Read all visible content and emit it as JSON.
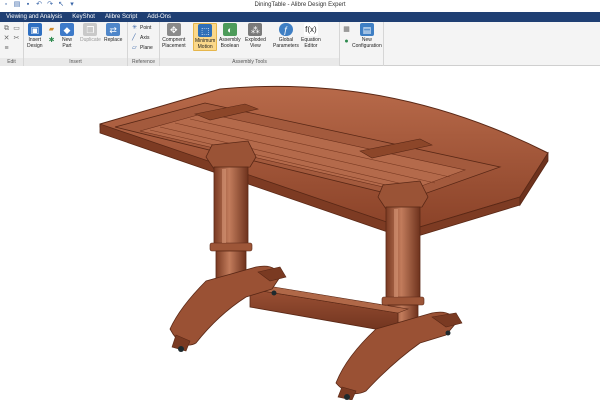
{
  "window": {
    "title": "DiningTable - Alibre Design Expert"
  },
  "menu": {
    "items": [
      "Viewing and Analysis",
      "KeyShot",
      "Alibre Script",
      "Add-Ons"
    ]
  },
  "ribbon": {
    "groups": {
      "edit": "Edit",
      "insert": "Insert",
      "reference": "Reference",
      "assembly_tools": "Assembly Tools"
    },
    "buttons": {
      "insert_design": "Insert\nDesign",
      "new_part": "New\nPart",
      "duplicate": "Duplicate",
      "replace": "Replace",
      "point": "Point",
      "axis": "Axis",
      "plane": "Plane",
      "component_placement": "Compnent\nPlacement",
      "minimum_motion": "Minimum\nMotion",
      "assembly_boolean": "Assembly\nBoolean",
      "exploded_view": "Exploded\nView",
      "global_parameters": "Global\nParameters",
      "equation_editor": "Equation\nEditor",
      "new_configuration": "New\nConfiguration"
    }
  },
  "colors": {
    "menubar": "#1f3f73",
    "ribbon": "#f4f4f4",
    "active_button": "#fbd88a",
    "wood": "#a5583c",
    "wood_dark": "#7a3a22",
    "wood_light": "#c78262"
  },
  "icons": {
    "qat": [
      "new-file-icon",
      "open-icon",
      "save-icon",
      "undo-icon",
      "redo-icon",
      "select-icon"
    ]
  }
}
